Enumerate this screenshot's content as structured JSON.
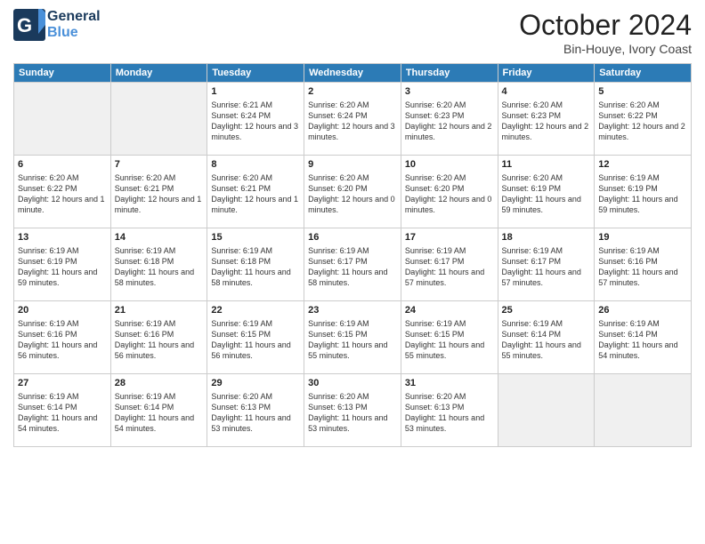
{
  "header": {
    "logo_general": "General",
    "logo_blue": "Blue",
    "month": "October 2024",
    "location": "Bin-Houye, Ivory Coast"
  },
  "days_of_week": [
    "Sunday",
    "Monday",
    "Tuesday",
    "Wednesday",
    "Thursday",
    "Friday",
    "Saturday"
  ],
  "weeks": [
    [
      {
        "day": "",
        "empty": true
      },
      {
        "day": "",
        "empty": true
      },
      {
        "day": "1",
        "sunrise": "6:21 AM",
        "sunset": "6:24 PM",
        "daylight": "12 hours and 3 minutes."
      },
      {
        "day": "2",
        "sunrise": "6:20 AM",
        "sunset": "6:24 PM",
        "daylight": "12 hours and 3 minutes."
      },
      {
        "day": "3",
        "sunrise": "6:20 AM",
        "sunset": "6:23 PM",
        "daylight": "12 hours and 2 minutes."
      },
      {
        "day": "4",
        "sunrise": "6:20 AM",
        "sunset": "6:23 PM",
        "daylight": "12 hours and 2 minutes."
      },
      {
        "day": "5",
        "sunrise": "6:20 AM",
        "sunset": "6:22 PM",
        "daylight": "12 hours and 2 minutes."
      }
    ],
    [
      {
        "day": "6",
        "sunrise": "6:20 AM",
        "sunset": "6:22 PM",
        "daylight": "12 hours and 1 minute."
      },
      {
        "day": "7",
        "sunrise": "6:20 AM",
        "sunset": "6:21 PM",
        "daylight": "12 hours and 1 minute."
      },
      {
        "day": "8",
        "sunrise": "6:20 AM",
        "sunset": "6:21 PM",
        "daylight": "12 hours and 1 minute."
      },
      {
        "day": "9",
        "sunrise": "6:20 AM",
        "sunset": "6:20 PM",
        "daylight": "12 hours and 0 minutes."
      },
      {
        "day": "10",
        "sunrise": "6:20 AM",
        "sunset": "6:20 PM",
        "daylight": "12 hours and 0 minutes."
      },
      {
        "day": "11",
        "sunrise": "6:20 AM",
        "sunset": "6:19 PM",
        "daylight": "11 hours and 59 minutes."
      },
      {
        "day": "12",
        "sunrise": "6:19 AM",
        "sunset": "6:19 PM",
        "daylight": "11 hours and 59 minutes."
      }
    ],
    [
      {
        "day": "13",
        "sunrise": "6:19 AM",
        "sunset": "6:19 PM",
        "daylight": "11 hours and 59 minutes."
      },
      {
        "day": "14",
        "sunrise": "6:19 AM",
        "sunset": "6:18 PM",
        "daylight": "11 hours and 58 minutes."
      },
      {
        "day": "15",
        "sunrise": "6:19 AM",
        "sunset": "6:18 PM",
        "daylight": "11 hours and 58 minutes."
      },
      {
        "day": "16",
        "sunrise": "6:19 AM",
        "sunset": "6:17 PM",
        "daylight": "11 hours and 58 minutes."
      },
      {
        "day": "17",
        "sunrise": "6:19 AM",
        "sunset": "6:17 PM",
        "daylight": "11 hours and 57 minutes."
      },
      {
        "day": "18",
        "sunrise": "6:19 AM",
        "sunset": "6:17 PM",
        "daylight": "11 hours and 57 minutes."
      },
      {
        "day": "19",
        "sunrise": "6:19 AM",
        "sunset": "6:16 PM",
        "daylight": "11 hours and 57 minutes."
      }
    ],
    [
      {
        "day": "20",
        "sunrise": "6:19 AM",
        "sunset": "6:16 PM",
        "daylight": "11 hours and 56 minutes."
      },
      {
        "day": "21",
        "sunrise": "6:19 AM",
        "sunset": "6:16 PM",
        "daylight": "11 hours and 56 minutes."
      },
      {
        "day": "22",
        "sunrise": "6:19 AM",
        "sunset": "6:15 PM",
        "daylight": "11 hours and 56 minutes."
      },
      {
        "day": "23",
        "sunrise": "6:19 AM",
        "sunset": "6:15 PM",
        "daylight": "11 hours and 55 minutes."
      },
      {
        "day": "24",
        "sunrise": "6:19 AM",
        "sunset": "6:15 PM",
        "daylight": "11 hours and 55 minutes."
      },
      {
        "day": "25",
        "sunrise": "6:19 AM",
        "sunset": "6:14 PM",
        "daylight": "11 hours and 55 minutes."
      },
      {
        "day": "26",
        "sunrise": "6:19 AM",
        "sunset": "6:14 PM",
        "daylight": "11 hours and 54 minutes."
      }
    ],
    [
      {
        "day": "27",
        "sunrise": "6:19 AM",
        "sunset": "6:14 PM",
        "daylight": "11 hours and 54 minutes."
      },
      {
        "day": "28",
        "sunrise": "6:19 AM",
        "sunset": "6:14 PM",
        "daylight": "11 hours and 54 minutes."
      },
      {
        "day": "29",
        "sunrise": "6:20 AM",
        "sunset": "6:13 PM",
        "daylight": "11 hours and 53 minutes."
      },
      {
        "day": "30",
        "sunrise": "6:20 AM",
        "sunset": "6:13 PM",
        "daylight": "11 hours and 53 minutes."
      },
      {
        "day": "31",
        "sunrise": "6:20 AM",
        "sunset": "6:13 PM",
        "daylight": "11 hours and 53 minutes."
      },
      {
        "day": "",
        "empty": true
      },
      {
        "day": "",
        "empty": true
      }
    ]
  ]
}
